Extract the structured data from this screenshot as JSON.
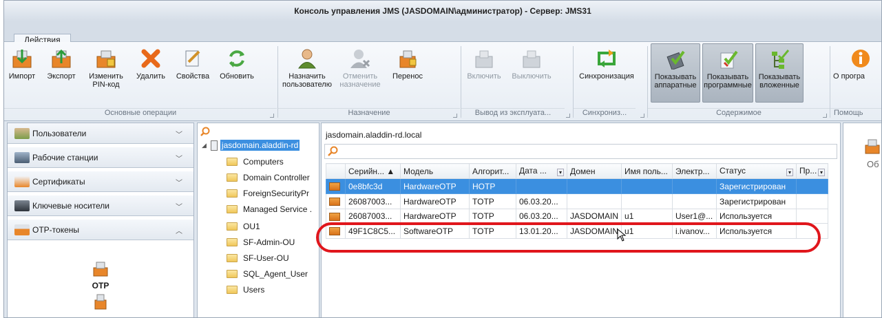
{
  "window": {
    "title": "Консоль управления JMS (JASDOMAIN\\администратор) - Сервер: JMS31"
  },
  "tabs": {
    "actions": "Действия"
  },
  "ribbon": {
    "buttons": [
      {
        "label": "Импорт",
        "label2": ""
      },
      {
        "label": "Экспорт",
        "label2": ""
      },
      {
        "label": "Изменить",
        "label2": "PIN-код"
      },
      {
        "label": "Удалить",
        "label2": ""
      },
      {
        "label": "Свойства",
        "label2": ""
      },
      {
        "label": "Обновить",
        "label2": ""
      },
      {
        "label": "Назначить",
        "label2": "пользователю"
      },
      {
        "label": "Отменить",
        "label2": "назначение"
      },
      {
        "label": "Перенос",
        "label2": ""
      },
      {
        "label": "Включить",
        "label2": ""
      },
      {
        "label": "Выключить",
        "label2": ""
      },
      {
        "label": "Синхронизация",
        "label2": ""
      },
      {
        "label": "Показывать",
        "label2": "аппаратные"
      },
      {
        "label": "Показывать",
        "label2": "программные"
      },
      {
        "label": "Показывать",
        "label2": "вложенные"
      },
      {
        "label": "О програ",
        "label2": ""
      }
    ],
    "groups": [
      "Основные операции",
      "Назначение",
      "Вывод из эксплуата...",
      "Синхрониз...",
      "Содержимое",
      "Помощь"
    ]
  },
  "nav": {
    "items": [
      "Пользователи",
      "Рабочие станции",
      "Сертификаты",
      "Ключевые носители",
      "OTP-токены"
    ],
    "selected_label": "OTP"
  },
  "tree": {
    "root": "jasdomain.aladdin-rd",
    "children": [
      "Computers",
      "Domain Controller",
      "ForeignSecurityPr",
      "Managed Service .",
      "OU1",
      "SF-Admin-OU",
      "SF-User-OU",
      "SQL_Agent_User",
      "Users"
    ]
  },
  "grid": {
    "title": "jasdomain.aladdin-rd.local",
    "columns": [
      "Серийн... ▲",
      "Модель",
      "Алгорит...",
      "Дата ...",
      "Домен",
      "Имя поль...",
      "Электр...",
      "Статус",
      "Пр..."
    ],
    "rows": [
      [
        "0e8bfc3d",
        "HardwareOTP",
        "HOTP",
        "",
        "",
        "",
        "",
        "Зарегистрирован",
        ""
      ],
      [
        "26087003...",
        "HardwareOTP",
        "TOTP",
        "06.03.20...",
        "",
        "",
        "",
        "Зарегистрирован",
        ""
      ],
      [
        "26087003...",
        "HardwareOTP",
        "TOTP",
        "06.03.20...",
        "JASDOMAIN",
        "u1",
        "User1@...",
        "Используется",
        ""
      ],
      [
        "49F1C8C5...",
        "SoftwareOTP",
        "TOTP",
        "13.01.20...",
        "JASDOMAIN",
        "u1",
        "i.ivanov...",
        "Используется",
        ""
      ]
    ]
  },
  "right": {
    "label": "Об"
  },
  "colors": {
    "accent": "#3b8fe0",
    "highlight": "#e0161c",
    "orange": "#e8862a"
  }
}
